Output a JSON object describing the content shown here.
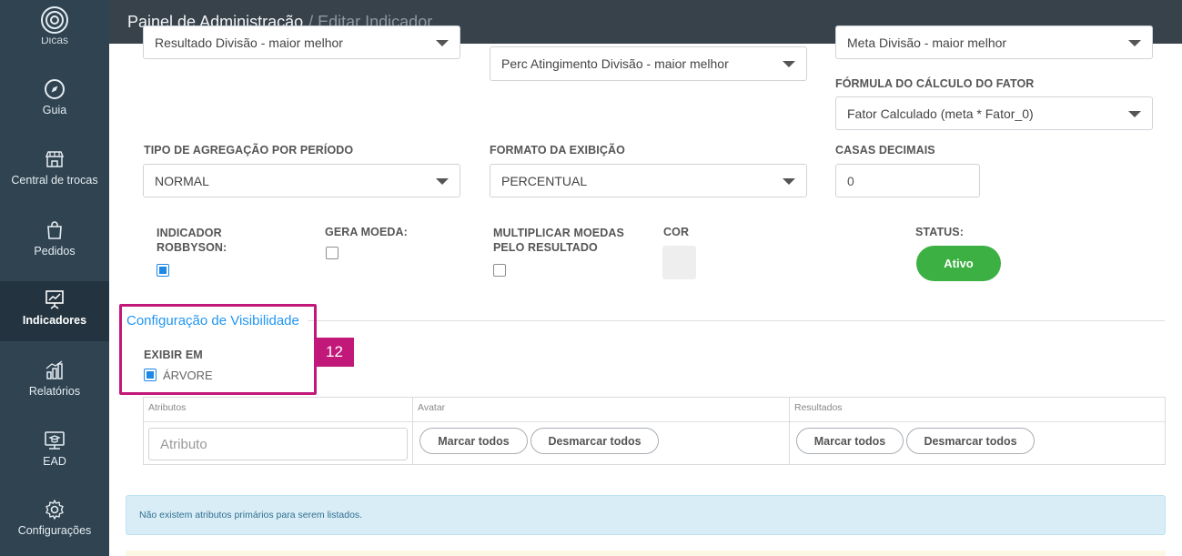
{
  "header": {
    "title": "Painel de Administração",
    "subtitle": "/ Editar Indicador"
  },
  "sidebar": {
    "items": [
      {
        "label": "Guia",
        "icon": "compass-icon"
      },
      {
        "label": "Central de trocas",
        "icon": "store-icon"
      },
      {
        "label": "Pedidos",
        "icon": "shopping-bag-icon"
      },
      {
        "label": "Indicadores",
        "icon": "presentation-chart-icon",
        "active": true
      },
      {
        "label": "Relatórios",
        "icon": "reports-chart-icon"
      },
      {
        "label": "EAD",
        "icon": "education-monitor-icon"
      },
      {
        "label": "Configurações",
        "icon": "gear-icon"
      }
    ],
    "cut_label": "Dicas"
  },
  "form": {
    "partial_row": {
      "left_value": "Resultado Divisão - maior melhor",
      "middle_value": "Perc Atingimento Divisão - maior melhor",
      "right_value": "Meta Divisão - maior melhor"
    },
    "formula_label": "FÓRMULA DO CÁLCULO DO FATOR",
    "formula_value": "Fator Calculado (meta * Fator_0)",
    "aggregation_label": "TIPO DE AGREGAÇÃO POR PERÍODO",
    "aggregation_value": "NORMAL",
    "format_label": "FORMATO DA EXIBIÇÃO",
    "format_value": "PERCENTUAL",
    "decimals_label": "CASAS DECIMAIS",
    "decimals_value": "0",
    "robbyson_label_1": "INDICADOR",
    "robbyson_label_2": "ROBBYSON:",
    "gera_moeda_label": "GERA MOEDA:",
    "multiplicar_label_1": "MULTIPLICAR MOEDAS",
    "multiplicar_label_2": "PELO RESULTADO",
    "cor_label": "COR",
    "status_label": "STATUS:",
    "status_button": "Ativo",
    "checkboxes": {
      "robbyson": true,
      "gera_moeda": false,
      "multiplicar": false
    }
  },
  "visibility": {
    "title": "Configuração de Visibilidade",
    "exibir_label": "EXIBIR EM",
    "arvore_label": "ÁRVORE",
    "arvore_checked": true,
    "callout_number": "12"
  },
  "attributes_table": {
    "headers": [
      "Atributos",
      "Avatar",
      "Resultados"
    ],
    "attribute_placeholder": "Atributo",
    "mark_all": "Marcar todos",
    "unmark_all": "Desmarcar todos"
  },
  "info_message": "Não existem atributos primários para serem listados.",
  "colors": {
    "sidebar": "#2f4350",
    "topbar": "#37424b",
    "accent": "#2196f3",
    "success": "#3cb043",
    "highlight": "#c2187a"
  }
}
